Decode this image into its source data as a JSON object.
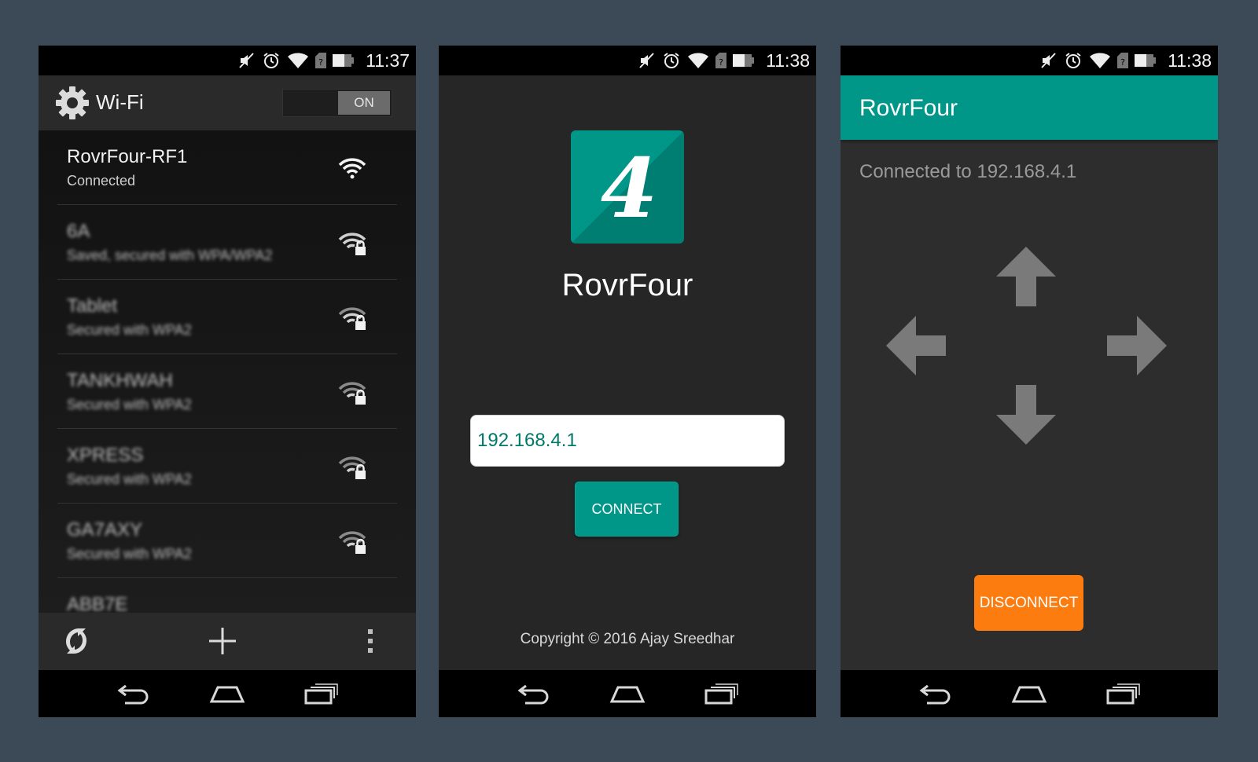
{
  "colors": {
    "background": "#3c4a57",
    "teal": "#009688",
    "orange": "#fd7c0f",
    "input_text": "#00796b"
  },
  "wifi_screen": {
    "status_time": "11:37",
    "title": "Wi-Fi",
    "toggle_label": "ON",
    "networks": [
      {
        "name": "RovrFour-RF1",
        "status": "Connected",
        "secured": false
      },
      {
        "name": "6A",
        "status": "Saved, secured with WPA/WPA2",
        "secured": true
      },
      {
        "name": "Tablet",
        "status": "Secured with WPA2",
        "secured": true
      },
      {
        "name": "TANKHWAH",
        "status": "Secured with WPA2",
        "secured": true
      },
      {
        "name": "XPRESS",
        "status": "Secured with WPA2",
        "secured": true
      },
      {
        "name": "GA7AXY",
        "status": "Secured with WPA2",
        "secured": true
      },
      {
        "name": "ABB7E",
        "status": "",
        "secured": true
      }
    ],
    "bottom_icons": [
      "wps-icon",
      "add-network-icon",
      "overflow-menu-icon"
    ]
  },
  "connect_screen": {
    "status_time": "11:38",
    "logo_glyph": "4",
    "app_name": "RovrFour",
    "ip_value": "192.168.4.1",
    "connect_label": "CONNECT",
    "copyright": "Copyright © 2016 Ajay Sreedhar"
  },
  "control_screen": {
    "status_time": "11:38",
    "app_bar_title": "RovrFour",
    "connected_text": "Connected to 192.168.4.1",
    "arrow_icons": [
      "arrow-up-icon",
      "arrow-left-icon",
      "arrow-right-icon",
      "arrow-down-icon"
    ],
    "disconnect_label": "DISCONNECT"
  },
  "status_icons": [
    "muted-speaker-icon",
    "alarm-icon",
    "wifi-signal-icon",
    "no-sim-icon",
    "battery-icon"
  ],
  "nav_icons": [
    "back-icon",
    "home-icon",
    "recent-apps-icon"
  ]
}
